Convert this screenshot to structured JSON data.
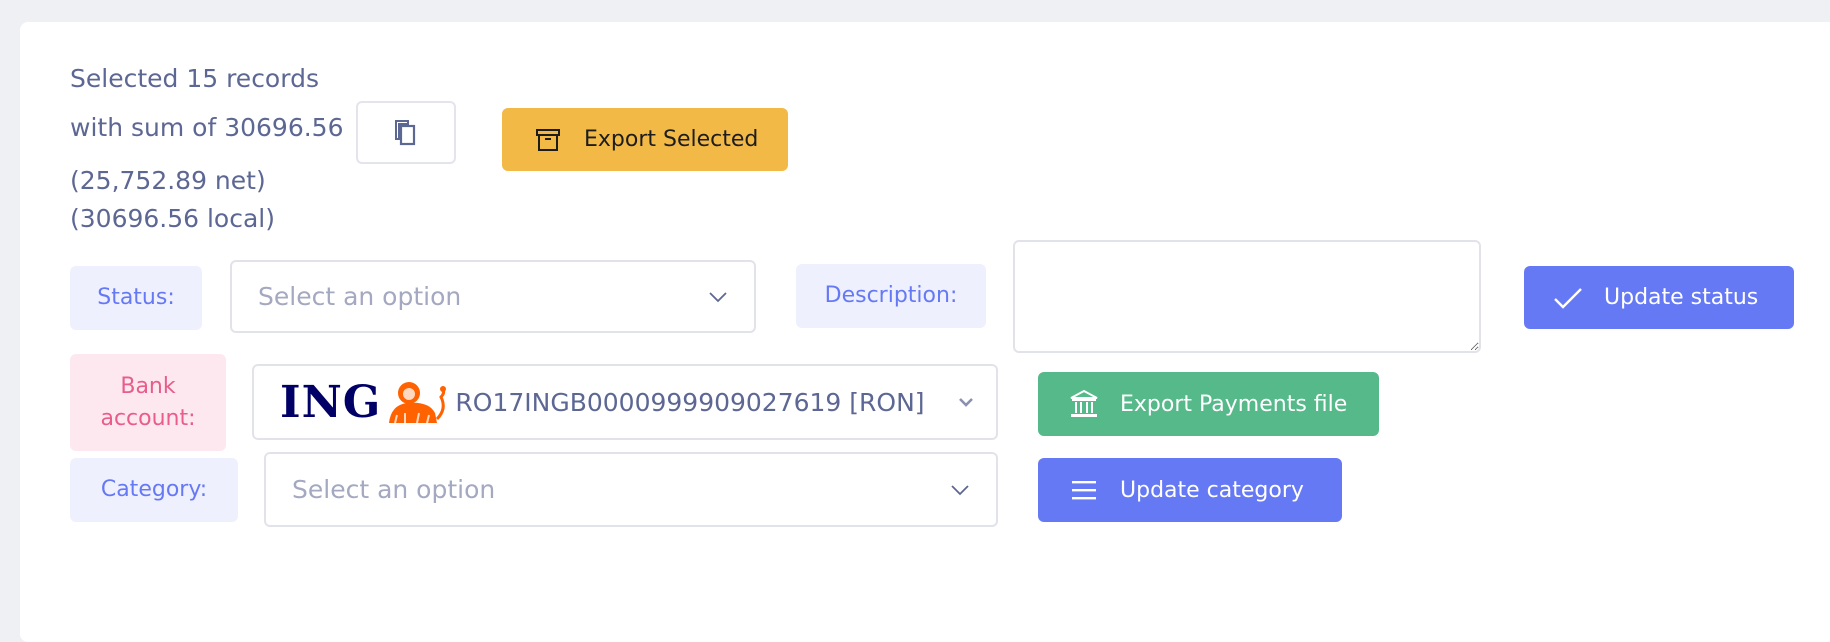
{
  "summary": {
    "line1": "Selected 15 records",
    "line2": "with sum of 30696.56",
    "line3": "(25,752.89 net)",
    "line4": "(30696.56 local)"
  },
  "toolbar": {
    "copy_icon": "copy-icon",
    "export_selected_label": "Export Selected",
    "export_selected_icon": "archive-box-icon"
  },
  "status": {
    "label": "Status:",
    "placeholder": "Select an option",
    "update_label": "Update status",
    "update_icon": "check-icon"
  },
  "description": {
    "label": "Description:",
    "value": ""
  },
  "bank": {
    "label_line1": "Bank",
    "label_line2": "account:",
    "logo_text": "ING",
    "logo_icon": "ing-lion-icon",
    "selected_value": "RO17INGB0000999909027619 [RON]",
    "export_label": "Export Payments file",
    "export_icon": "bank-building-icon"
  },
  "category": {
    "label": "Category:",
    "placeholder": "Select an option",
    "update_label": "Update category",
    "update_icon": "list-icon"
  },
  "colors": {
    "primary": "#6679f5",
    "warning": "#f2b947",
    "success": "#55b98a",
    "danger_label": "#e85d8a",
    "text": "#5d6793"
  }
}
